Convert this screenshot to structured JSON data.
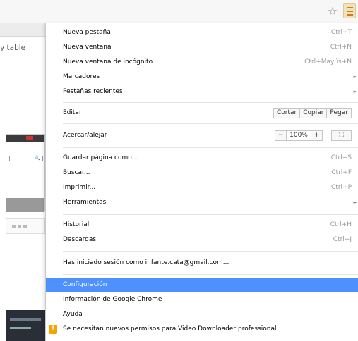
{
  "toolbar": {
    "star_icon": "star-outline-icon",
    "menu_icon": "hamburger-menu-icon",
    "accent": "#d07c16"
  },
  "background_page": {
    "visible_text": "y table"
  },
  "menu": {
    "group1": [
      {
        "label": "Nueva pestaña",
        "shortcut": "Ctrl+T"
      },
      {
        "label": "Nueva ventana",
        "shortcut": "Ctrl+N"
      },
      {
        "label": "Nueva ventana de incógnito",
        "shortcut": "Ctrl+Mayús+N"
      },
      {
        "label": "Marcadores",
        "submenu": true
      },
      {
        "label": "Pestañas recientes",
        "submenu": true
      }
    ],
    "edit": {
      "label": "Editar",
      "cut": "Cortar",
      "copy": "Copiar",
      "paste": "Pegar"
    },
    "zoom": {
      "label": "Acercar/alejar",
      "minus": "−",
      "value": "100%",
      "plus": "+",
      "fullscreen": "⛶"
    },
    "group2": [
      {
        "label": "Guardar página como...",
        "shortcut": "Ctrl+S"
      },
      {
        "label": "Buscar...",
        "shortcut": "Ctrl+F"
      },
      {
        "label": "Imprimir...",
        "shortcut": "Ctrl+P"
      },
      {
        "label": "Herramientas",
        "submenu": true
      }
    ],
    "group3": [
      {
        "label": "Historial",
        "shortcut": "Ctrl+H"
      },
      {
        "label": "Descargas",
        "shortcut": "Ctrl+J"
      }
    ],
    "signed_in": "Has iniciado sesión como infante.cata@gmail.com...",
    "group4": [
      {
        "label": "Configuración",
        "selected": true
      },
      {
        "label": "Información de Google Chrome"
      },
      {
        "label": "Ayuda"
      },
      {
        "label": "Se necesitan nuevos permisos para Video Downloader professional",
        "warning": true
      }
    ],
    "selected_color": "#4d90fe",
    "warning_color": "#f5a400"
  }
}
